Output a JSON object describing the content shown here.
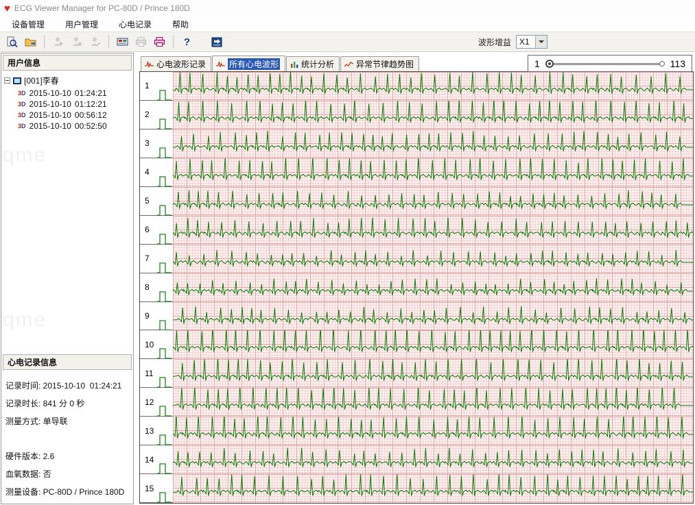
{
  "window": {
    "title": "ECG Viewer Manager for PC-80D / Prince 180D"
  },
  "menu": {
    "items": [
      "设备管理",
      "用户管理",
      "心电记录",
      "帮助"
    ]
  },
  "toolbar": {
    "gain_label": "波形增益",
    "gain_value": "X1",
    "help_label": "?",
    "buttons": [
      "query-record",
      "export-folder",
      "user-add",
      "user-delete",
      "user-edit",
      "record-device",
      "print",
      "print-preview",
      "help",
      "data-transfer"
    ]
  },
  "sidebar": {
    "user_panel_title": "用户信息",
    "tree": {
      "root_label": "[001]李春",
      "record_icon_text_3": "3",
      "record_icon_text_d": "D",
      "records": [
        {
          "date": "2015-10-10",
          "time": "01:24:21"
        },
        {
          "date": "2015-10-10",
          "time": "01:12:21"
        },
        {
          "date": "2015-10-10",
          "time": "00:56:12"
        },
        {
          "date": "2015-10-10",
          "time": "00:52:50"
        }
      ]
    },
    "record_panel_title": "心电记录信息",
    "record_info": [
      {
        "text": "记录时间: 2015-10-10  01:24:21"
      },
      {
        "text": "记录时长: 841 分 0 秒"
      },
      {
        "text": "测量方式: 单导联"
      },
      {
        "text": "硬件版本: 2.6"
      },
      {
        "text": "血氧数据: 否"
      },
      {
        "text": "测量设备: PC-80D / Prince 180D"
      }
    ]
  },
  "tabs": [
    {
      "label": "心电波形记录",
      "active": false
    },
    {
      "label": "所有心电波形",
      "active": true
    },
    {
      "label": "统计分析",
      "active": false
    },
    {
      "label": "异常节律趋势图",
      "active": false
    }
  ],
  "pager": {
    "start": "1",
    "end": "113"
  },
  "ecg": {
    "rows": [
      1,
      2,
      3,
      4,
      5,
      6,
      7,
      8,
      9,
      10,
      11,
      12,
      13,
      14,
      15
    ],
    "noisy_row": 9,
    "trace_color": "#067a06",
    "grid_minor_color": "#f6d3d3",
    "grid_major_color": "#e8a3a3"
  },
  "watermark": "qme",
  "titlebar_heart_icon": "♥"
}
